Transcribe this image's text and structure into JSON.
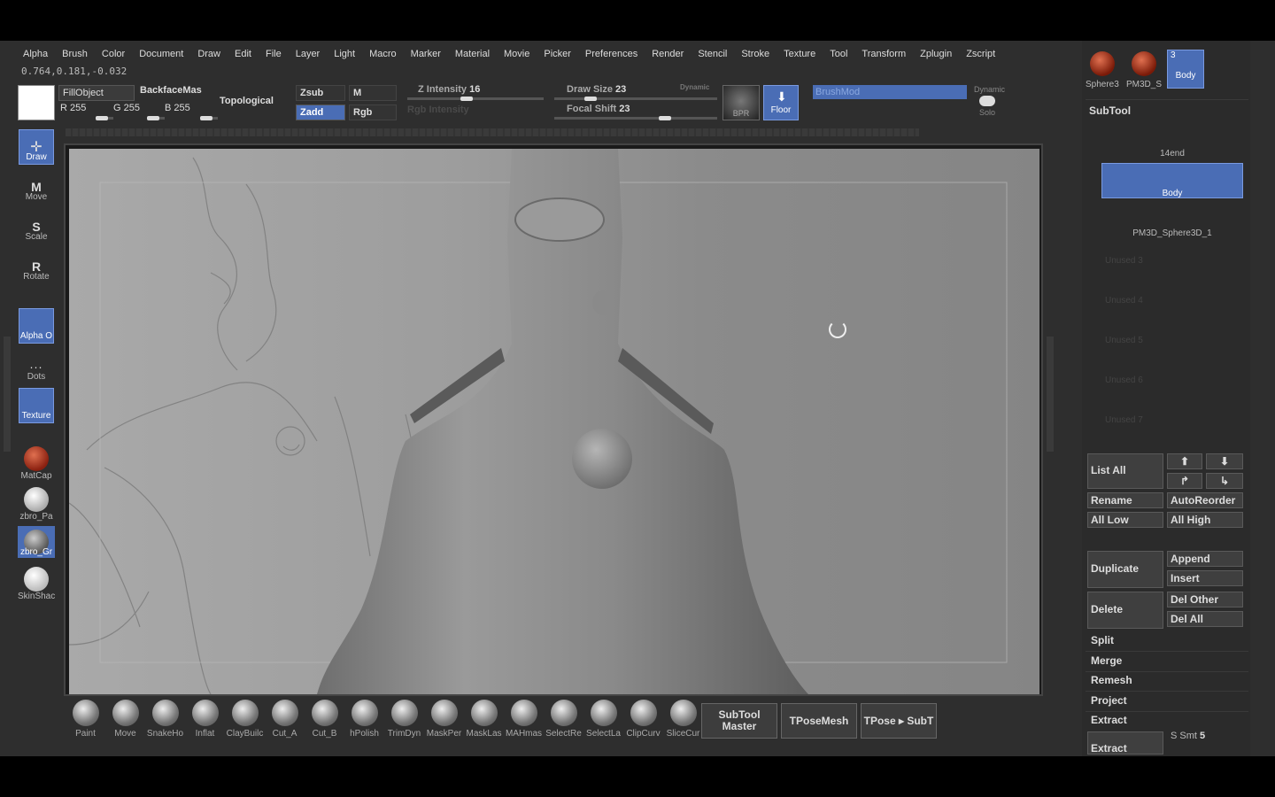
{
  "menu": [
    "Alpha",
    "Brush",
    "Color",
    "Document",
    "Draw",
    "Edit",
    "File",
    "Layer",
    "Light",
    "Macro",
    "Marker",
    "Material",
    "Movie",
    "Picker",
    "Preferences",
    "Render",
    "Stencil",
    "Stroke",
    "Texture",
    "Tool",
    "Transform",
    "Zplugin",
    "Zscript"
  ],
  "coords": "0.764,0.181,-0.032",
  "toolbar": {
    "fill_object": "FillObject",
    "r": "R 255",
    "g": "G 255",
    "b": "B 255",
    "backface": "BackfaceMas",
    "topological": "Topological",
    "zsub": "Zsub",
    "zadd": "Zadd",
    "m": "M",
    "rgb": "Rgb",
    "z_intensity_label": "Z Intensity",
    "z_intensity": "16",
    "rgb_intensity": "Rgb Intensity",
    "draw_size_label": "Draw Size",
    "draw_size": "23",
    "dynamic": "Dynamic",
    "focal_shift_label": "Focal Shift",
    "focal_shift": "23",
    "bpr": "BPR",
    "floor": "Floor",
    "brushmod": "BrushMod",
    "dynamic2": "Dynamic",
    "solo": "Solo"
  },
  "left_shelf": {
    "draw": "Draw",
    "move": "Move",
    "scale": "Scale",
    "rotate": "Rotate",
    "alpha": "Alpha O",
    "dots": "Dots",
    "texture": "Texture",
    "matcap": "MatCap",
    "zbro_pa": "zbro_Pa",
    "zbro_gr": "zbro_Gr",
    "skinshad": "SkinShac"
  },
  "bottom_shelf": [
    "Paint",
    "Move",
    "SnakeHo",
    "Inflat",
    "ClayBuilc",
    "Cut_A",
    "Cut_B",
    "hPolish",
    "TrimDyn",
    "MaskPer",
    "MaskLas",
    "MAHmas",
    "SelectRe",
    "SelectLa",
    "ClipCurv",
    "SliceCur"
  ],
  "bottom_buttons": {
    "subtool_master": "SubTool Master",
    "tposemesh": "TPoseMesh",
    "tpose_subt": "TPose ▸ SubT"
  },
  "right_panel": {
    "thumbs": [
      "Sphere3",
      "PM3D_S",
      "Body"
    ],
    "thumb_count": "3",
    "subtool_title": "SubTool",
    "subtools": [
      "14end",
      "Body",
      "PM3D_Sphere3D_1"
    ],
    "unused": [
      "Unused 3",
      "Unused 4",
      "Unused 5",
      "Unused 6",
      "Unused 7"
    ],
    "list_all": "List All",
    "rename": "Rename",
    "autoreorder": "AutoReorder",
    "all_low": "All Low",
    "all_high": "All High",
    "duplicate": "Duplicate",
    "append": "Append",
    "insert": "Insert",
    "delete": "Delete",
    "del_other": "Del Other",
    "del_all": "Del All",
    "split": "Split",
    "merge": "Merge",
    "remesh": "Remesh",
    "project": "Project",
    "extract": "Extract",
    "extract_btn": "Extract",
    "s_smt": "S Smt",
    "s_smt_val": "5"
  },
  "colors": {
    "accent": "#4a6db5",
    "panel": "#2e2e2e",
    "canvas": "#9a9a9a"
  }
}
